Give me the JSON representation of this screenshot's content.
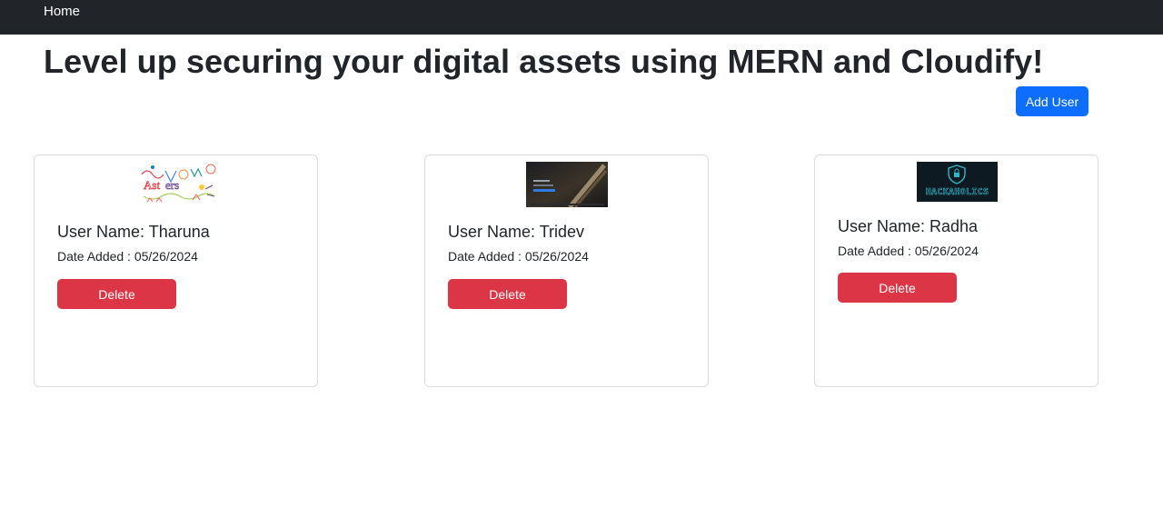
{
  "nav": {
    "home_label": "Home"
  },
  "header": {
    "title": "Level up securing your digital assets using MERN and Cloudify!"
  },
  "actions": {
    "add_user_label": "Add User"
  },
  "users": [
    {
      "name_label": "User Name: Tharuna",
      "date_label": "Date Added : 05/26/2024",
      "delete_label": "Delete",
      "image": "colorful-doodle-thumbnail"
    },
    {
      "name_label": "User Name: Tridev",
      "date_label": "Date Added : 05/26/2024",
      "delete_label": "Delete",
      "image": "desktop-wallpaper-thumbnail"
    },
    {
      "name_label": "User Name: Radha",
      "date_label": "Date Added : 05/26/2024",
      "delete_label": "Delete",
      "image": "hackaholics-logo-thumbnail",
      "image_text": "HACKAHOLICS"
    }
  ],
  "colors": {
    "navbar": "#212529",
    "primary": "#0d6efd",
    "danger": "#dc3545",
    "card_border": "#d9dcdf"
  }
}
